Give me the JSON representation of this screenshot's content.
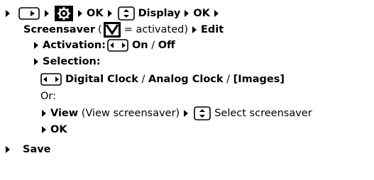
{
  "line1": {
    "ok1": "OK",
    "display": "Display",
    "ok2": "OK"
  },
  "line2": {
    "screensaver": "Screensaver",
    "paren_open": "(",
    "activated": "= activated)",
    "edit": "Edit"
  },
  "line3": {
    "activation": "Activation:",
    "on": "On",
    "sep": " / ",
    "off": "Off"
  },
  "line4": {
    "selection": "Selection:"
  },
  "line5": {
    "digital": "Digital Clock",
    "sep1": " / ",
    "analog": "Analog Clock",
    "sep2": " / ",
    "images": "[Images]"
  },
  "line6": {
    "or": "Or:"
  },
  "line7": {
    "view": "View",
    "view_desc": " (View screensaver)",
    "select": "Select screensaver"
  },
  "line8": {
    "ok": "OK"
  },
  "line9": {
    "save": "Save"
  }
}
